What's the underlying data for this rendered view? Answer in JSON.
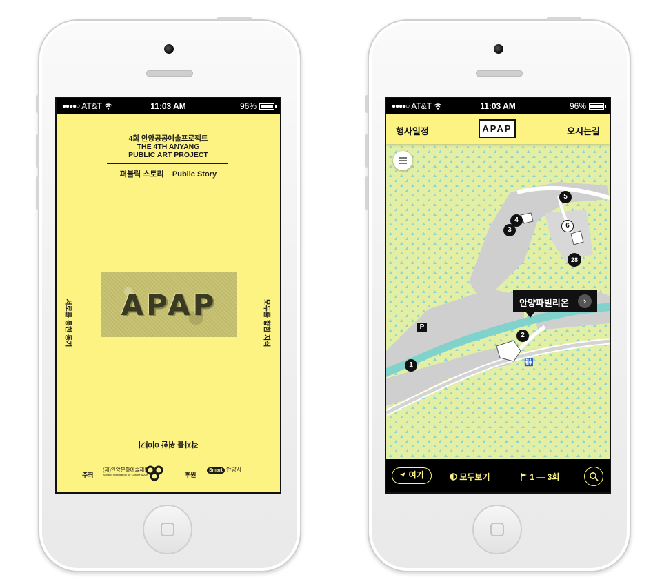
{
  "status_bar": {
    "carrier": "AT&T",
    "time": "11:03 AM",
    "battery": "96%"
  },
  "cover": {
    "title_lines": [
      "4회 안양공공예술프로젝트",
      "THE 4TH ANYANG",
      "PUBLIC ART PROJECT"
    ],
    "subtitle": "퍼블릭 스토리    Public Story",
    "photo_text": "APAP",
    "vertical_left": "서로를 통한 동기",
    "vertical_right": "모두를 향한 지식",
    "bottom_rotated": "각자를 위한 이야기",
    "footer": {
      "host_label": "주최",
      "host_name": "(재)안양문화예술재단",
      "host_name_en": "Anyang Foundation for Culture & Arts",
      "sponsor_label": "후원",
      "sponsor_logo_text": "Smart",
      "sponsor_name": "안양시"
    }
  },
  "map_screen": {
    "header": {
      "left_link": "행사일정",
      "logo": "APAP",
      "right_link": "오시는길"
    },
    "callout_label": "안양파빌리온",
    "markers": [
      "5",
      "4",
      "3",
      "6",
      "28",
      "2",
      "1"
    ],
    "parking_label": "P",
    "bottom_bar": {
      "here": "여기",
      "show_all": "모두보기",
      "range": "1 — 3회"
    },
    "colors": {
      "map_bg": "#e3efa4",
      "road": "#d4d4d4",
      "river": "#7fd3cc",
      "accent_yellow": "#fdf383"
    }
  }
}
